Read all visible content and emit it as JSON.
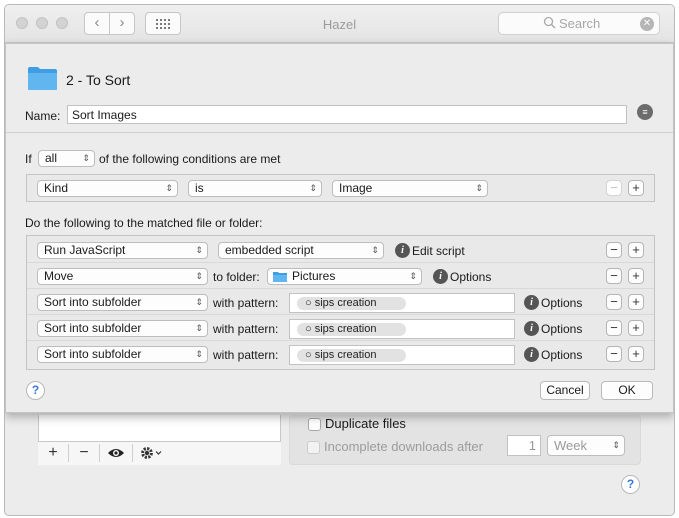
{
  "window": {
    "title": "Hazel",
    "search_placeholder": "Search",
    "nav_back": "‹",
    "nav_forward": "›"
  },
  "background": {
    "duplicate_files_label": "Duplicate files",
    "incomplete_downloads_label": "Incomplete downloads after",
    "incomplete_value": "1",
    "incomplete_unit": "Week",
    "help_label": "?"
  },
  "sheet": {
    "folder_name": "2 - To Sort",
    "name_label": "Name:",
    "name_value": "Sort Images",
    "if_label": "If",
    "match_mode": "all",
    "conditions_suffix": "of the following conditions are met",
    "condition": {
      "attribute": "Kind",
      "operator": "is",
      "value": "Image"
    },
    "actions_header": "Do the following to the matched file or folder:",
    "actions": [
      {
        "type": "Run JavaScript",
        "target": "embedded script",
        "link": "Edit script"
      },
      {
        "type": "Move",
        "middle_label": "to folder:",
        "target": "Pictures",
        "link": "Options"
      },
      {
        "type": "Sort into subfolder",
        "middle_label": "with pattern:",
        "token": "sips creation",
        "link": "Options"
      },
      {
        "type": "Sort into subfolder",
        "middle_label": "with pattern:",
        "token": "sips creation",
        "link": "Options"
      },
      {
        "type": "Sort into subfolder",
        "middle_label": "with pattern:",
        "token": "sips creation",
        "link": "Options"
      }
    ],
    "help_label": "?",
    "cancel_label": "Cancel",
    "ok_label": "OK"
  },
  "icons": [
    "search-icon",
    "clear-icon",
    "folder-icon",
    "notes-icon",
    "info-icon",
    "eye-icon",
    "gear-icon",
    "help-icon"
  ]
}
